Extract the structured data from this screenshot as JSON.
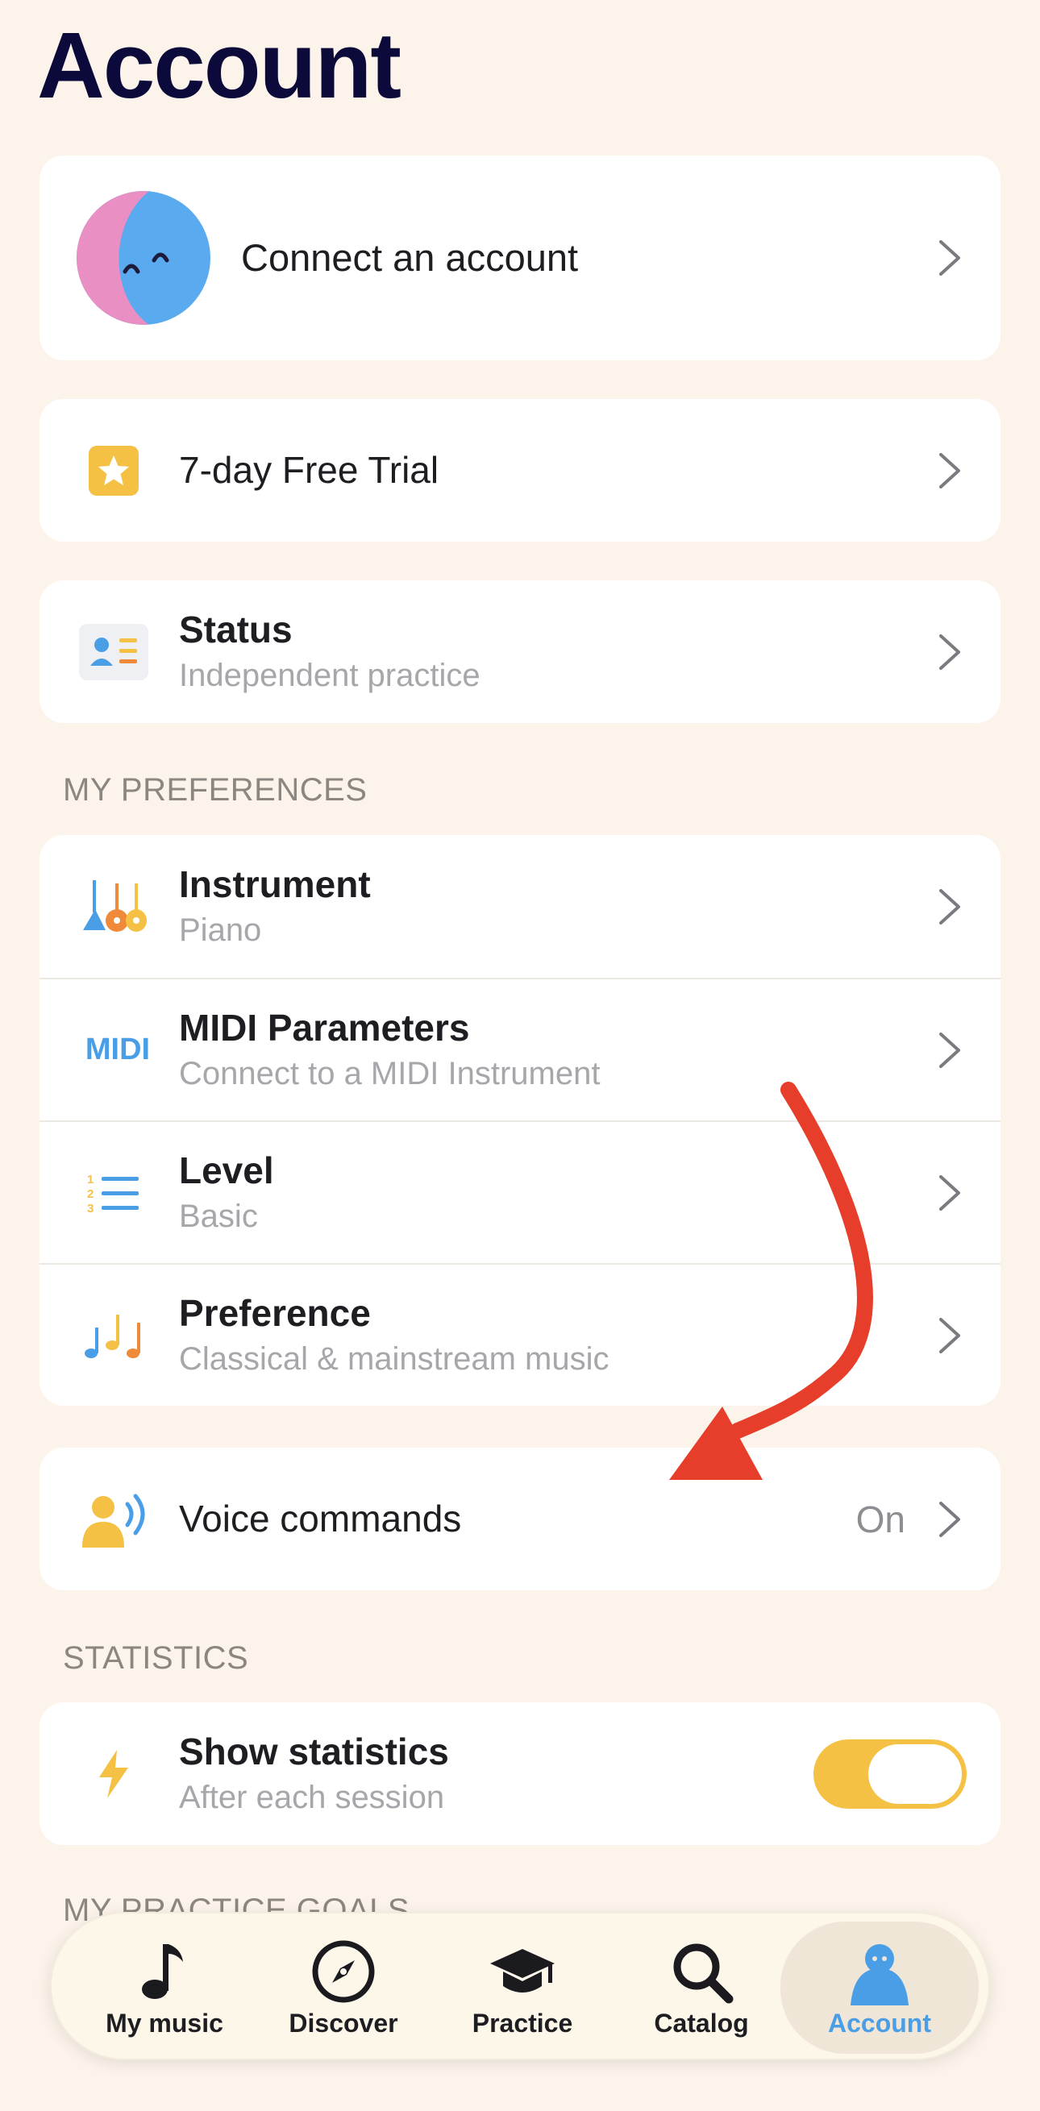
{
  "page": {
    "title": "Account"
  },
  "account": {
    "connect_label": "Connect an account"
  },
  "trial": {
    "label": "7-day Free Trial"
  },
  "status": {
    "label": "Status",
    "value": "Independent practice"
  },
  "preferences": {
    "header": "MY PREFERENCES",
    "items": [
      {
        "label": "Instrument",
        "value": "Piano",
        "icon": "instruments-icon"
      },
      {
        "label": "MIDI Parameters",
        "value": "Connect to a MIDI Instrument",
        "icon": "midi-icon",
        "icon_text": "MIDI"
      },
      {
        "label": "Level",
        "value": "Basic",
        "icon": "numbered-list-icon"
      },
      {
        "label": "Preference",
        "value": "Classical & mainstream music",
        "icon": "music-notes-icon"
      }
    ]
  },
  "voice": {
    "label": "Voice commands",
    "value": "On"
  },
  "statistics": {
    "header": "STATISTICS",
    "show_label": "Show statistics",
    "show_sub": "After each session",
    "toggle_on": true
  },
  "goals": {
    "header": "MY PRACTICE GOALS"
  },
  "tabbar": {
    "tabs": [
      {
        "label": "My music",
        "icon": "music-note-icon"
      },
      {
        "label": "Discover",
        "icon": "compass-icon"
      },
      {
        "label": "Practice",
        "icon": "graduation-cap-icon"
      },
      {
        "label": "Catalog",
        "icon": "search-icon"
      },
      {
        "label": "Account",
        "icon": "account-icon",
        "active": true
      }
    ]
  },
  "colors": {
    "background": "#fcf4ea",
    "title": "#0c0a3a",
    "accent_blue": "#4a9ee6",
    "accent_yellow": "#f5c144",
    "annotation_arrow": "#e63e2a"
  }
}
